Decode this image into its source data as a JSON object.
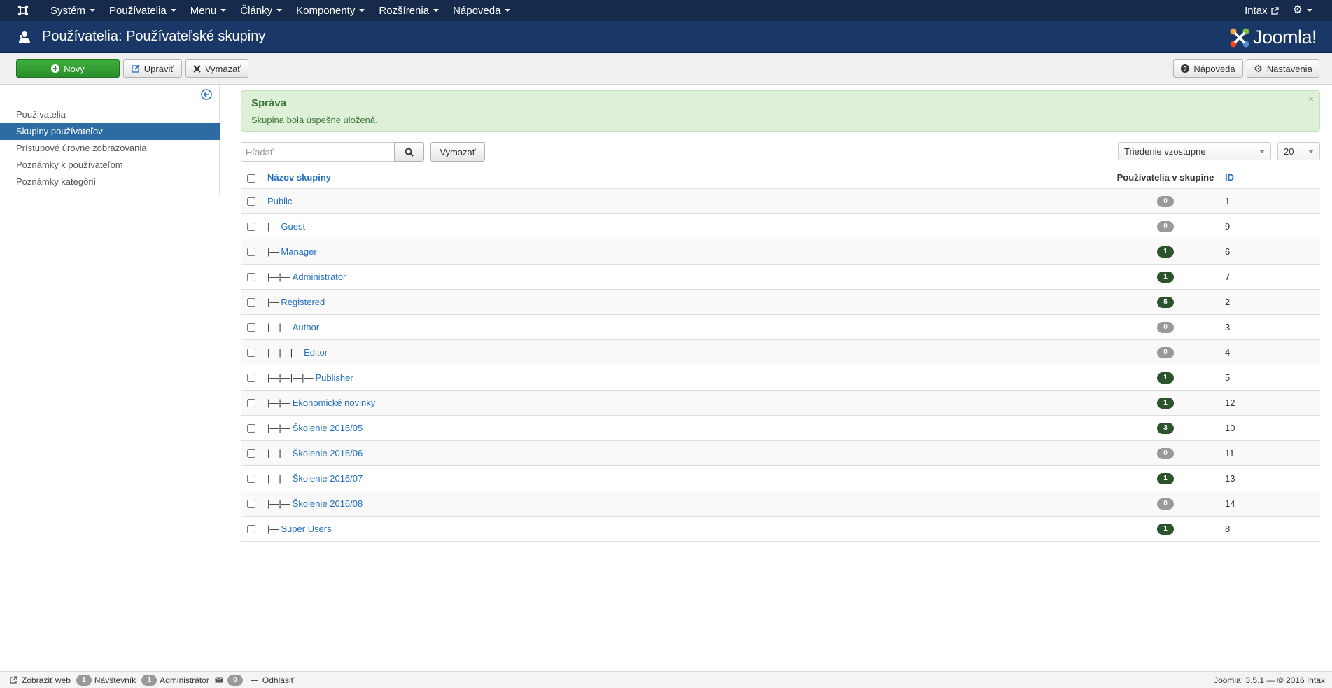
{
  "navbar": {
    "menu": [
      "Systém",
      "Používatelia",
      "Menu",
      "Články",
      "Komponenty",
      "Rozšírenia",
      "Nápoveda"
    ],
    "user_label": "Intax"
  },
  "header": {
    "title": "Používatelia: Používateľské skupiny",
    "brand": "Joomla!"
  },
  "toolbar": {
    "new_label": "Nový",
    "edit_label": "Upraviť",
    "delete_label": "Vymazať",
    "help_label": "Nápoveda",
    "options_label": "Nastavenia"
  },
  "sidebar": {
    "items": [
      {
        "label": "Používatelia",
        "active": false
      },
      {
        "label": "Skupiny používateľov",
        "active": true
      },
      {
        "label": "Prístupové úrovne zobrazovania",
        "active": false
      },
      {
        "label": "Poznámky k používateľom",
        "active": false
      },
      {
        "label": "Poznámky kategórií",
        "active": false
      }
    ]
  },
  "alert": {
    "heading": "Správa",
    "text": "Skupina bola úspešne uložená."
  },
  "filters": {
    "search_placeholder": "Hľadať",
    "search_value": "",
    "clear_label": "Vymazať",
    "sort_value": "Triedenie vzostupne",
    "limit_value": "20"
  },
  "table": {
    "headers": {
      "title": "Názov skupiny",
      "count": "Používatelia v skupine",
      "id": "ID"
    },
    "rows": [
      {
        "prefix": "",
        "title": "Public",
        "count": 0,
        "id": 1
      },
      {
        "prefix": "|—",
        "title": "Guest",
        "count": 0,
        "id": 9
      },
      {
        "prefix": "|—",
        "title": "Manager",
        "count": 1,
        "id": 6
      },
      {
        "prefix": "|—|—",
        "title": "Administrator",
        "count": 1,
        "id": 7
      },
      {
        "prefix": "|—",
        "title": "Registered",
        "count": 5,
        "id": 2
      },
      {
        "prefix": "|—|—",
        "title": "Author",
        "count": 0,
        "id": 3
      },
      {
        "prefix": "|—|—|—",
        "title": "Editor",
        "count": 0,
        "id": 4
      },
      {
        "prefix": "|—|—|—|—",
        "title": "Publisher",
        "count": 1,
        "id": 5
      },
      {
        "prefix": "|—|—",
        "title": "Ekonomické novinky",
        "count": 1,
        "id": 12
      },
      {
        "prefix": "|—|—",
        "title": "Školenie 2016/05",
        "count": 3,
        "id": 10
      },
      {
        "prefix": "|—|—",
        "title": "Školenie 2016/06",
        "count": 0,
        "id": 11
      },
      {
        "prefix": "|—|—",
        "title": "Školenie 2016/07",
        "count": 1,
        "id": 13
      },
      {
        "prefix": "|—|—",
        "title": "Školenie 2016/08",
        "count": 0,
        "id": 14
      },
      {
        "prefix": "|—",
        "title": "Super Users",
        "count": 1,
        "id": 8
      }
    ]
  },
  "statusbar": {
    "view_site": "Zobraziť web",
    "visitors_count": "1",
    "visitors_label": "Návštevník",
    "admins_count": "1",
    "admins_label": "Administrátor",
    "messages_count": "0",
    "logout_label": "Odhlásiť",
    "version": "Joomla! 3.5.1  —  © 2016 Intax"
  },
  "colors": {
    "navbar": "#162a4c",
    "header": "#1a3867",
    "success_button": "#2f9e2f",
    "sidebar_active": "#2d6ca2",
    "alert_bg": "#dff0d8",
    "badge_positive": "#2b542c",
    "badge_zero": "#999999"
  }
}
